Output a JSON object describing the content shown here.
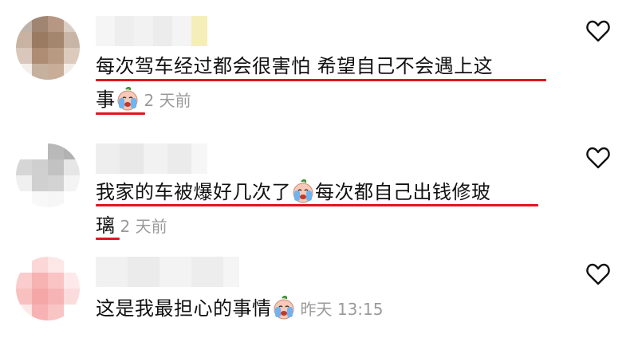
{
  "comments": [
    {
      "line1": "每次驾车经过都会很害怕 希望自己不会遇上这",
      "line2": "事",
      "emoji": "crying-face-emoji",
      "time": "2 天前"
    },
    {
      "line1": "我家的车被爆好几次了",
      "line1_after_emoji": "每次都自己出钱修玻",
      "line2": "璃",
      "emoji": "crying-face-emoji",
      "time": "2 天前"
    },
    {
      "line1": "这是我最担心的事情",
      "emoji": "crying-face-emoji",
      "time": "昨天 13:15"
    }
  ],
  "icons": {
    "like": "heart-outline-icon"
  },
  "colors": {
    "underline": "#e0161b",
    "timestamp": "#9a9a9a",
    "text": "#111111"
  }
}
